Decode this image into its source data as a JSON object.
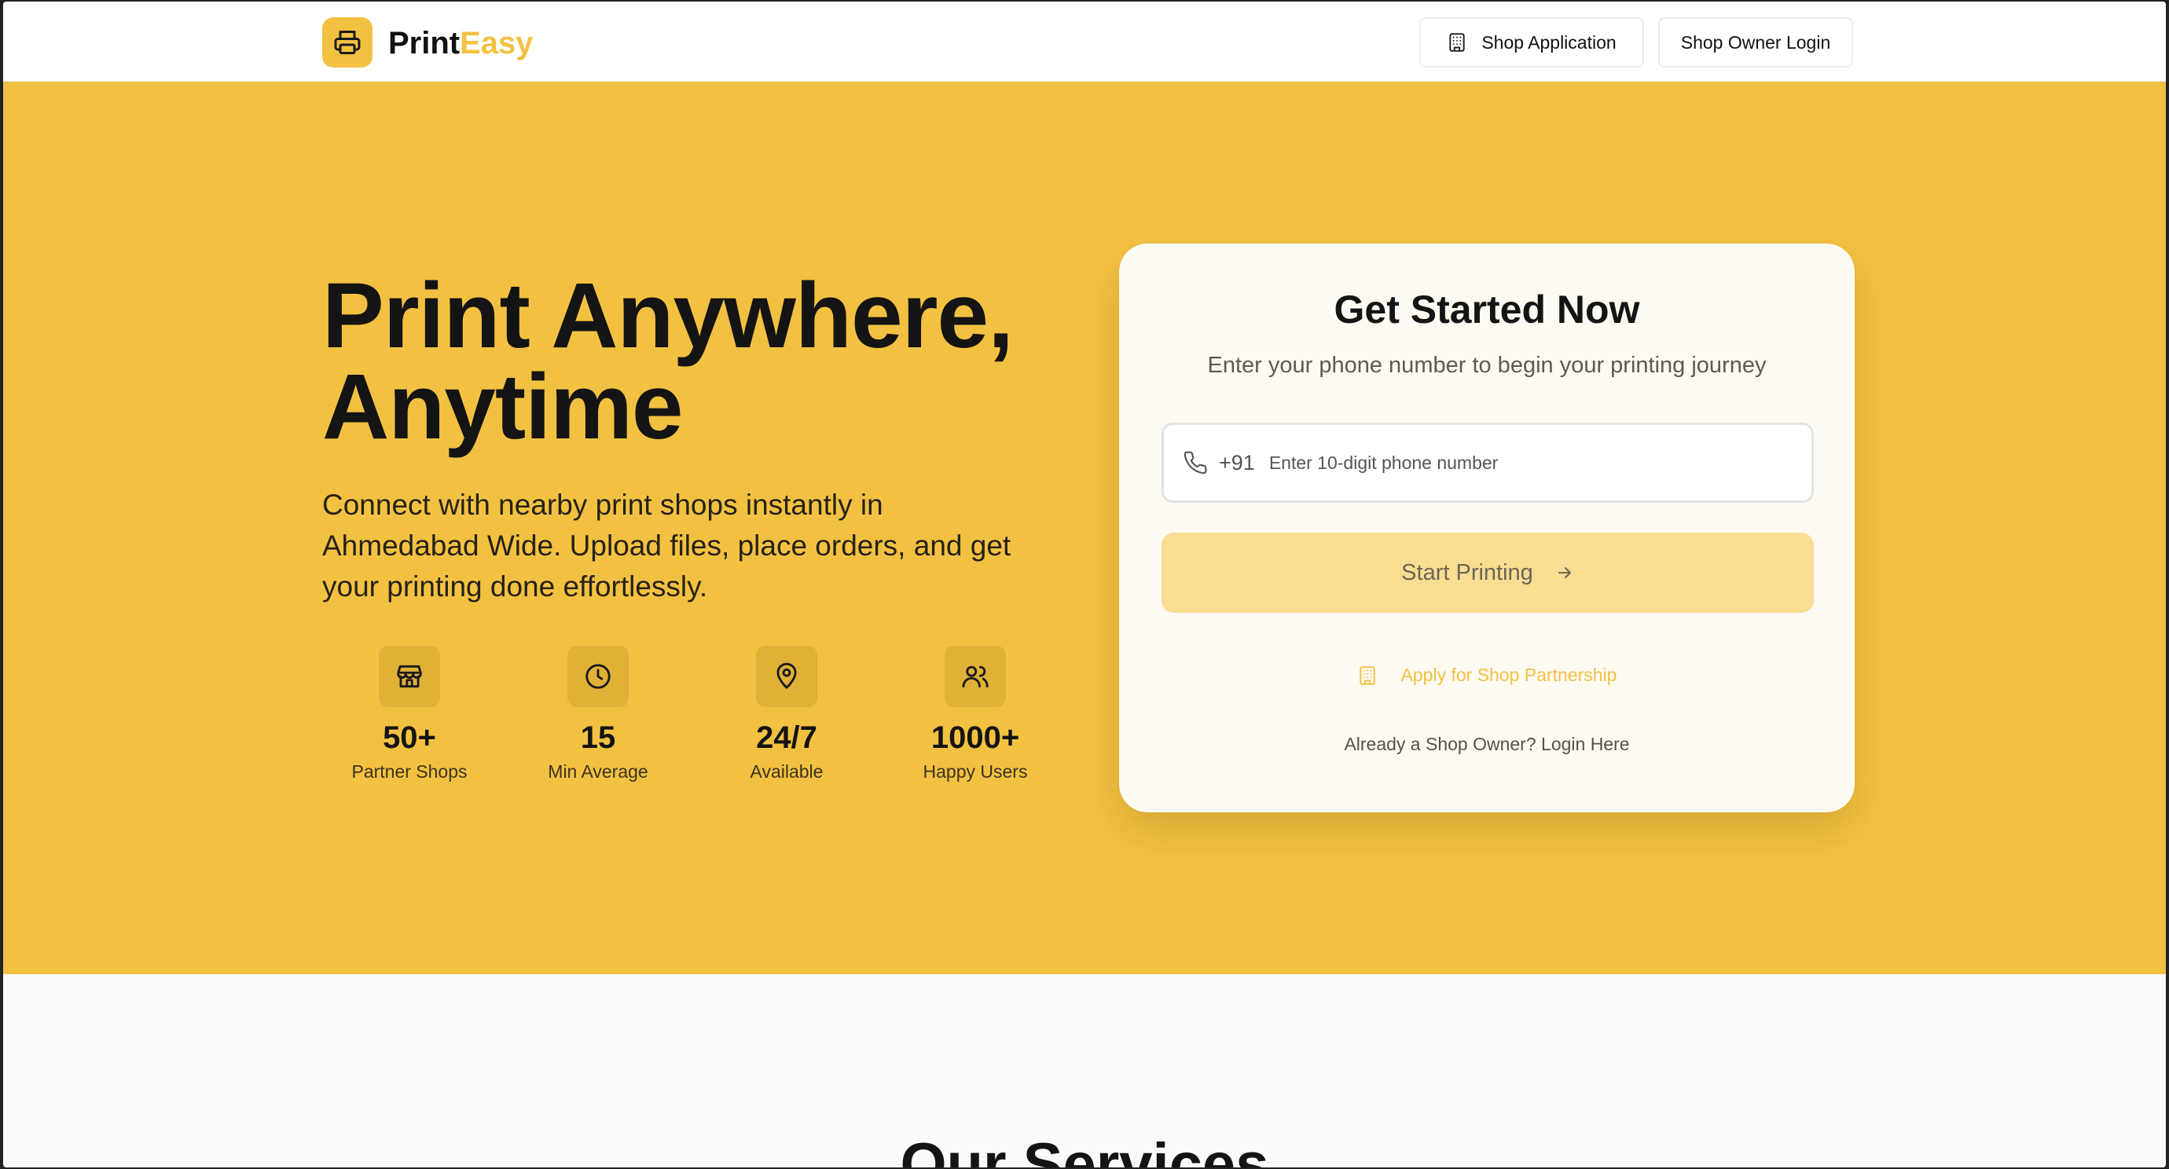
{
  "header": {
    "brand_part1": "Print",
    "brand_part2": "Easy",
    "shop_application_label": "Shop Application",
    "shop_owner_login_label": "Shop Owner Login"
  },
  "hero": {
    "title_line1": "Print Anywhere,",
    "title_line2": "Anytime",
    "description": "Connect with nearby print shops instantly in Ahmedabad Wide. Upload files, place orders, and get your printing done effortlessly.",
    "stats": [
      {
        "value": "50+",
        "label": "Partner Shops",
        "icon": "store-icon"
      },
      {
        "value": "15",
        "label": "Min Average",
        "icon": "clock-icon"
      },
      {
        "value": "24/7",
        "label": "Available",
        "icon": "location-pin-icon"
      },
      {
        "value": "1000+",
        "label": "Happy Users",
        "icon": "users-icon"
      }
    ]
  },
  "card": {
    "title": "Get Started Now",
    "subtitle": "Enter your phone number to begin your printing journey",
    "phone_prefix": "+91",
    "phone_placeholder": "Enter 10-digit phone number",
    "start_label": "Start Printing",
    "apply_label": "Apply for Shop Partnership",
    "login_label": "Already a Shop Owner? Login Here"
  },
  "services": {
    "title": "Our Services"
  },
  "colors": {
    "accent": "#f3c142",
    "start_button_disabled": "#f9dd93",
    "card_bg": "#fdfaf2"
  }
}
